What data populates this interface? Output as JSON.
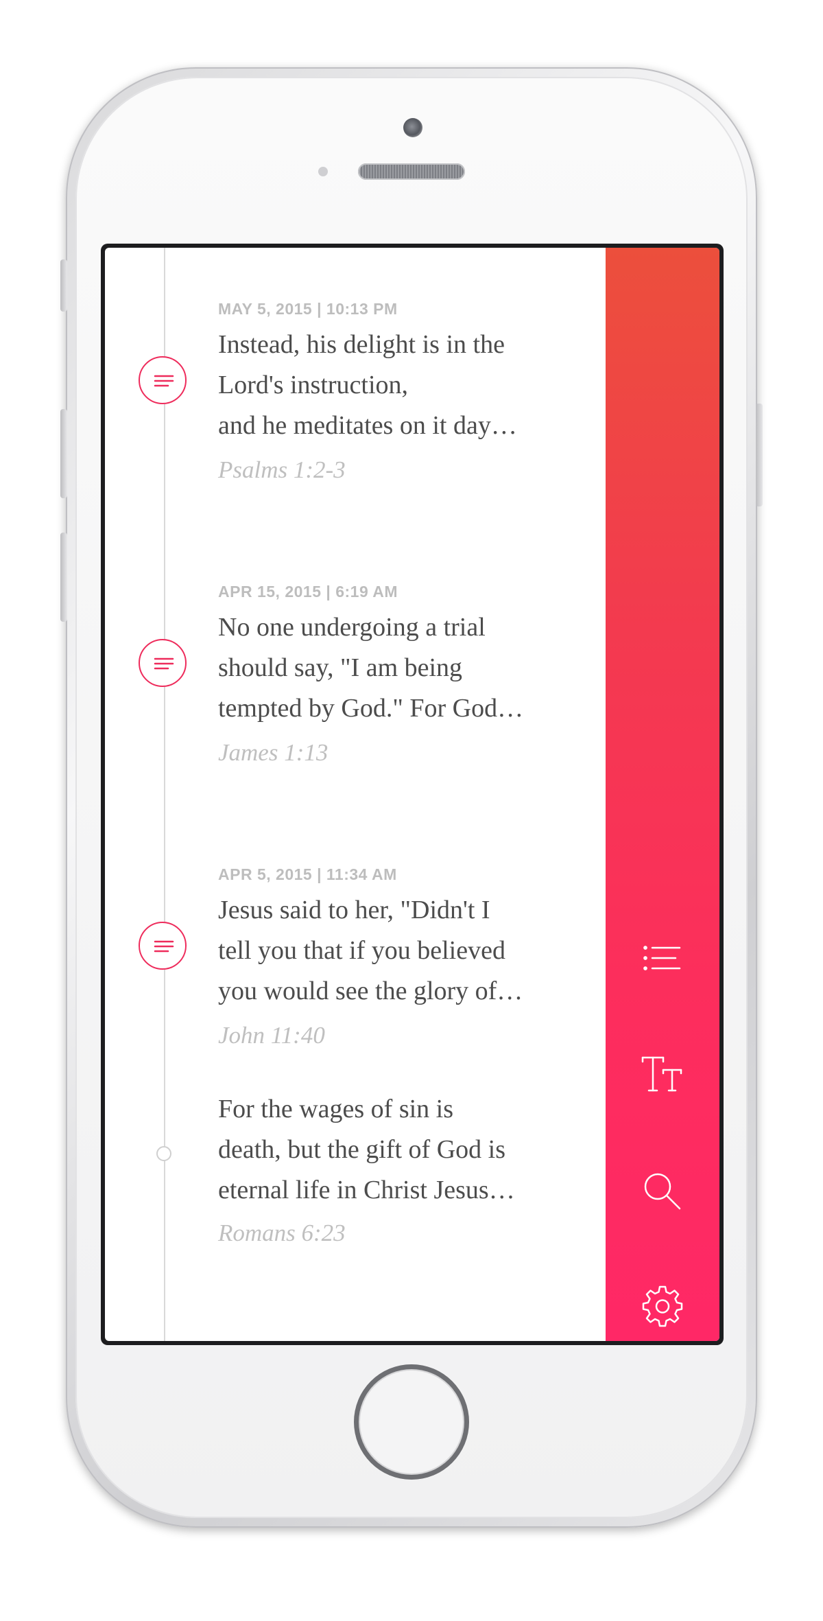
{
  "entries": [
    {
      "date": "MAY 5, 2015  |  10:13 PM",
      "lines": [
        "Instead, his delight is in the",
        "Lord's instruction,",
        "and he meditates on it day…"
      ],
      "reference": "Psalms 1:2-3",
      "has_note": true
    },
    {
      "date": "APR 15, 2015  |  6:19 AM",
      "lines": [
        "No one undergoing a trial",
        "should say, \"I am being",
        "tempted by God.\" For God…"
      ],
      "reference": "James 1:13",
      "has_note": true
    },
    {
      "date": "APR 5, 2015  |  11:34 AM",
      "lines": [
        "Jesus said to her, \"Didn't I",
        "tell you that if you believed",
        "you would see the glory of…"
      ],
      "reference": "John 11:40",
      "has_note": true
    },
    {
      "date": "",
      "lines": [
        "For the wages of sin is",
        "death, but the gift of God is",
        "eternal life in Christ Jesus…"
      ],
      "reference": "Romans 6:23",
      "has_note": false
    }
  ],
  "sidebar": {
    "icons": [
      "list-icon",
      "text-size-icon",
      "search-icon",
      "settings-gear-icon"
    ]
  },
  "colors": {
    "accent": "#ee2b5b",
    "sidebar_top": "#ec4f3c",
    "sidebar_bottom": "#ff2866",
    "body_text": "#4c4c4c",
    "muted_text": "#bdbdbd"
  }
}
